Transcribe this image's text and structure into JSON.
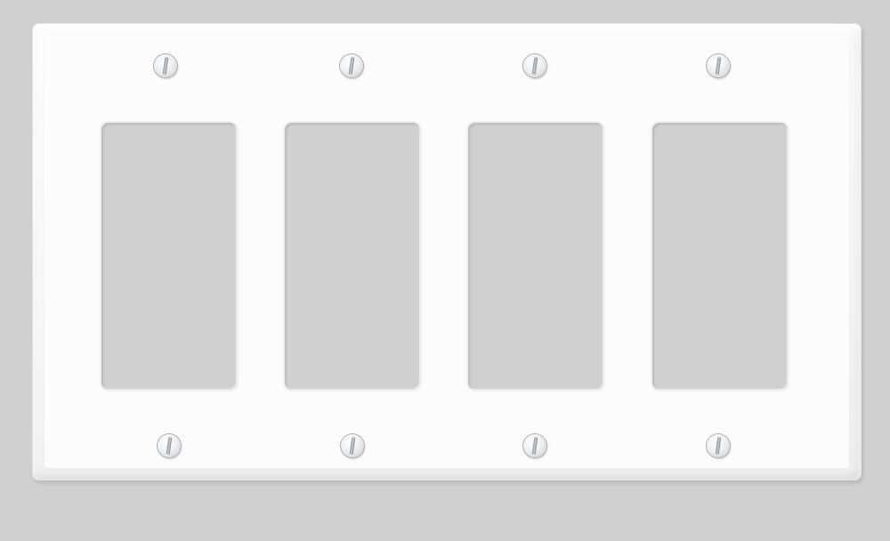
{
  "scene": {
    "subject": "wall-plate",
    "colors": {
      "background": "#d2cfcf",
      "plate": "#f9f9f9",
      "opening": "#d2cfcf",
      "screw": "#eef0f2"
    }
  },
  "plate": {
    "gang_count": 4,
    "openings": [
      {
        "id": "opening-1"
      },
      {
        "id": "opening-2"
      },
      {
        "id": "opening-3"
      },
      {
        "id": "opening-4"
      }
    ],
    "screws": {
      "top": [
        {
          "id": "screw-top-1"
        },
        {
          "id": "screw-top-2"
        },
        {
          "id": "screw-top-3"
        },
        {
          "id": "screw-top-4"
        }
      ],
      "bottom": [
        {
          "id": "screw-bottom-1"
        },
        {
          "id": "screw-bottom-2"
        },
        {
          "id": "screw-bottom-3"
        },
        {
          "id": "screw-bottom-4"
        }
      ]
    }
  }
}
